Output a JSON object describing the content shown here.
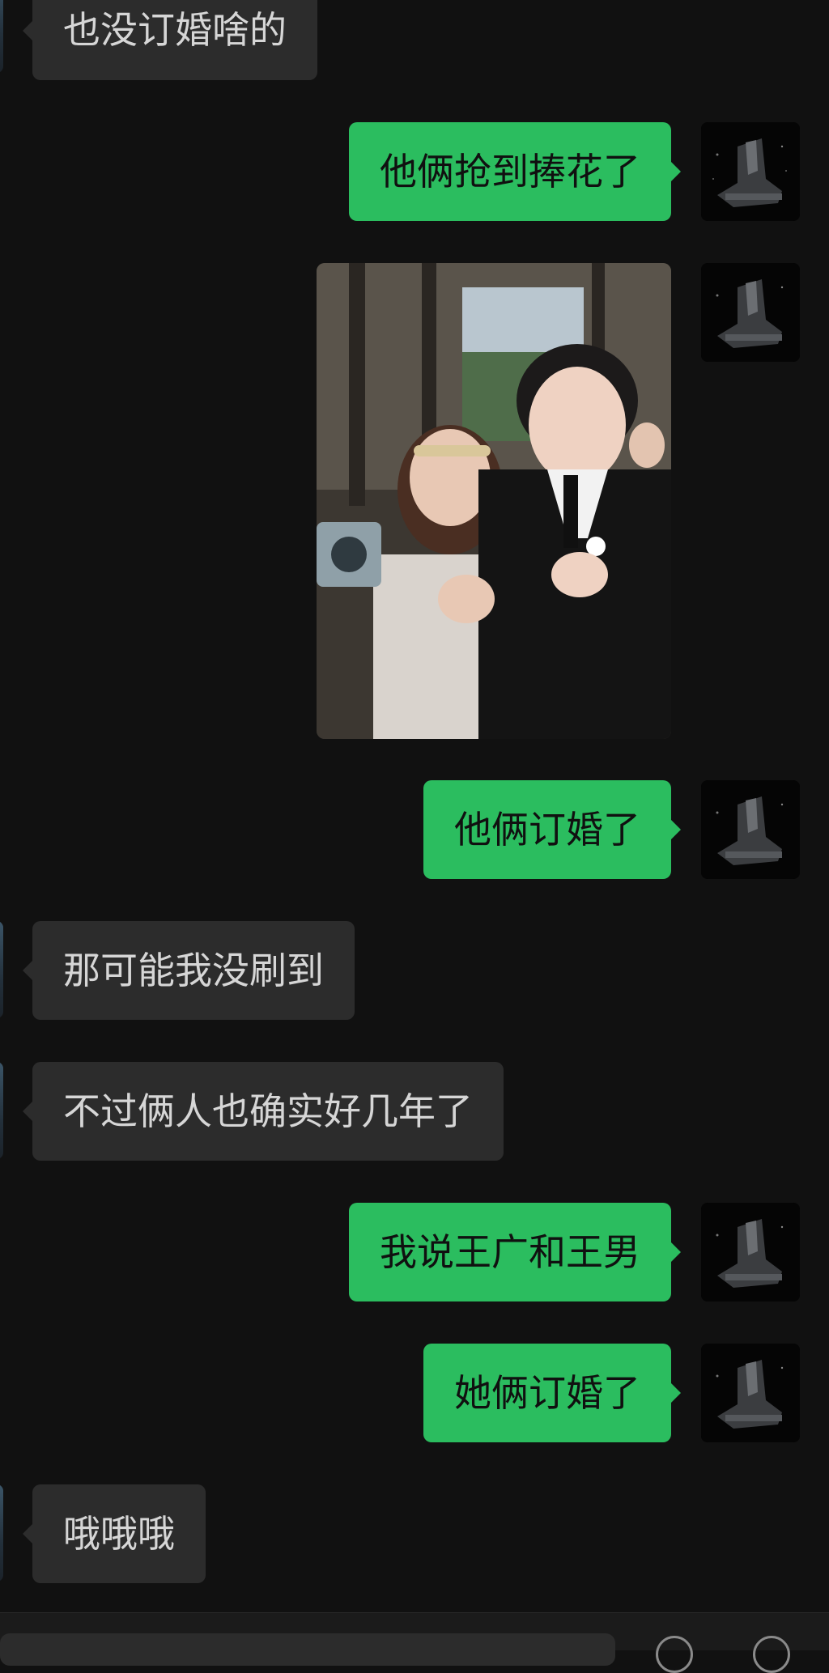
{
  "messages": [
    {
      "side": "in",
      "text": "也没订婚啥的"
    },
    {
      "side": "out",
      "text": "他俩抢到捧花了"
    },
    {
      "side": "out",
      "type": "image"
    },
    {
      "side": "out",
      "text": "他俩订婚了"
    },
    {
      "side": "in",
      "text": "那可能我没刷到"
    },
    {
      "side": "in",
      "text": "不过俩人也确实好几年了"
    },
    {
      "side": "out",
      "text": "我说王广和王男"
    },
    {
      "side": "out",
      "text": "她俩订婚了"
    },
    {
      "side": "in",
      "text": "哦哦哦"
    }
  ],
  "colors": {
    "background": "#111111",
    "incoming_bubble": "#2c2c2c",
    "outgoing_bubble": "#2bbd5f"
  },
  "icons": {
    "outgoing_avatar": "dark-scifi-avatar-icon",
    "input_buttons": [
      "voice-icon",
      "emoji-icon"
    ]
  }
}
